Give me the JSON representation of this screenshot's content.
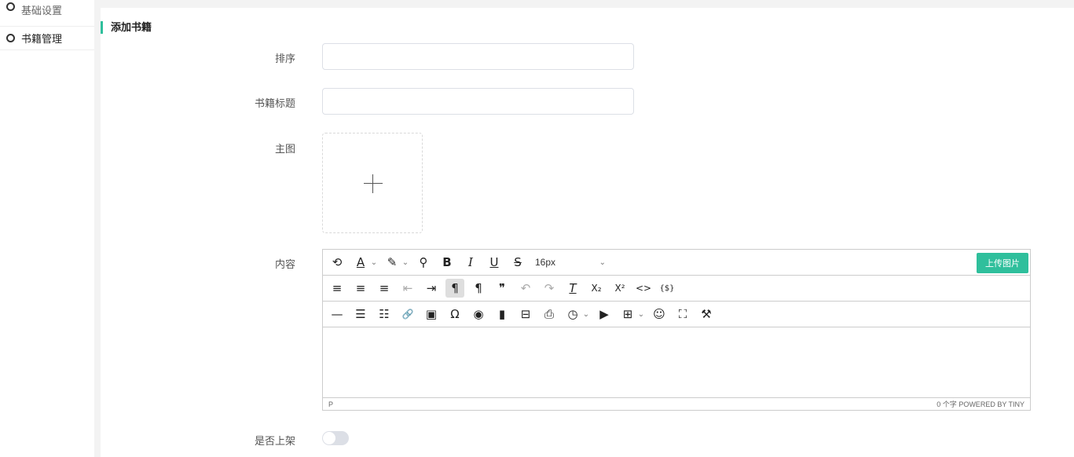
{
  "sidebar": {
    "items": [
      {
        "label": "基础设置"
      },
      {
        "label": "书籍管理"
      }
    ]
  },
  "form": {
    "section_title": "添加书籍",
    "fields": {
      "sort": {
        "label": "排序",
        "value": ""
      },
      "book_title": {
        "label": "书籍标题",
        "value": ""
      },
      "main_image": {
        "label": "主图"
      },
      "content": {
        "label": "内容"
      },
      "on_shelf": {
        "label": "是否上架",
        "enabled": false
      }
    }
  },
  "editor": {
    "font_size": "16px",
    "upload_image_label": "上传图片",
    "status_path": "P",
    "word_count": "0 个字",
    "branding": "POWERED BY TINY",
    "toolbar_row1": [
      {
        "name": "history-icon",
        "glyph": "⟲"
      },
      {
        "name": "text-color-icon",
        "glyph": "A"
      },
      {
        "name": "highlight-color-icon",
        "glyph": "✎"
      },
      {
        "name": "search-icon",
        "glyph": "⚲"
      },
      {
        "name": "bold-icon",
        "glyph": "B"
      },
      {
        "name": "italic-icon",
        "glyph": "I"
      },
      {
        "name": "underline-icon",
        "glyph": "U"
      },
      {
        "name": "strikethrough-icon",
        "glyph": "S"
      }
    ],
    "toolbar_row2": [
      {
        "name": "align-left-icon",
        "glyph": "≡"
      },
      {
        "name": "align-center-icon",
        "glyph": "≡"
      },
      {
        "name": "align-right-icon",
        "glyph": "≡"
      },
      {
        "name": "outdent-icon",
        "glyph": "⇤"
      },
      {
        "name": "indent-icon",
        "glyph": "⇥"
      },
      {
        "name": "ltr-icon",
        "glyph": "¶"
      },
      {
        "name": "rtl-icon",
        "glyph": "¶"
      },
      {
        "name": "blockquote-icon",
        "glyph": "❞"
      },
      {
        "name": "undo-icon",
        "glyph": "↶"
      },
      {
        "name": "redo-icon",
        "glyph": "↷"
      },
      {
        "name": "clear-format-icon",
        "glyph": "T"
      },
      {
        "name": "subscript-icon",
        "glyph": "X₂"
      },
      {
        "name": "superscript-icon",
        "glyph": "X²"
      },
      {
        "name": "code-icon",
        "glyph": "<>"
      },
      {
        "name": "template-icon",
        "glyph": "{$}"
      }
    ],
    "toolbar_row3": [
      {
        "name": "horizontal-rule-icon",
        "glyph": "—"
      },
      {
        "name": "bullet-list-icon",
        "glyph": "☰"
      },
      {
        "name": "numbered-list-icon",
        "glyph": "☷"
      },
      {
        "name": "link-icon",
        "glyph": "🔗"
      },
      {
        "name": "image-icon",
        "glyph": "▣"
      },
      {
        "name": "special-char-icon",
        "glyph": "Ω"
      },
      {
        "name": "preview-icon",
        "glyph": "◉"
      },
      {
        "name": "bookmark-icon",
        "glyph": "▮"
      },
      {
        "name": "page-break-icon",
        "glyph": "⊟"
      },
      {
        "name": "print-icon",
        "glyph": "⎙"
      },
      {
        "name": "datetime-icon",
        "glyph": "◷"
      },
      {
        "name": "media-icon",
        "glyph": "▶"
      },
      {
        "name": "table-icon",
        "glyph": "⊞"
      },
      {
        "name": "emoji-icon",
        "glyph": "☺"
      },
      {
        "name": "fullscreen-icon",
        "glyph": "⛶"
      },
      {
        "name": "format-painter-icon",
        "glyph": "⚒"
      }
    ]
  },
  "colors": {
    "accent": "#2fbf9c",
    "border": "#dcdfe6"
  }
}
